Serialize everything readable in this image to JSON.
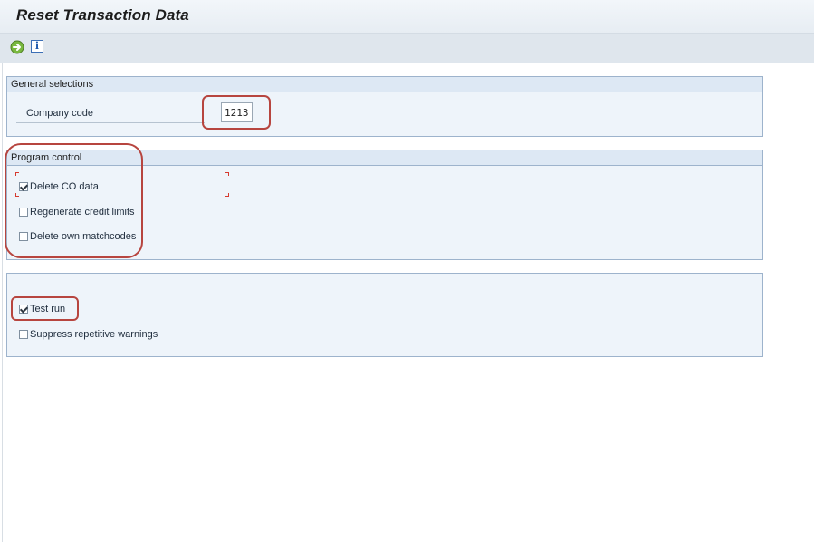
{
  "window": {
    "title": "Reset Transaction Data"
  },
  "toolbar": {
    "execute_icon": "execute-icon",
    "info_icon": "information-icon",
    "info_glyph": "i"
  },
  "general_selections": {
    "title": "General selections",
    "company_code_label": "Company code",
    "company_code_value": "1213"
  },
  "program_control": {
    "title": "Program control",
    "options": [
      {
        "label": "Delete CO data",
        "checked": true
      },
      {
        "label": "Regenerate credit limits",
        "checked": false
      },
      {
        "label": "Delete own matchcodes",
        "checked": false
      }
    ]
  },
  "run_options": {
    "options": [
      {
        "label": "Test run",
        "checked": true
      },
      {
        "label": "Suppress repetitive warnings",
        "checked": false
      }
    ]
  },
  "colors": {
    "highlight": "#b7453f",
    "group_background": "#eef4fa",
    "group_header": "#dde8f4",
    "toolbar_background": "#dfe6ed"
  }
}
